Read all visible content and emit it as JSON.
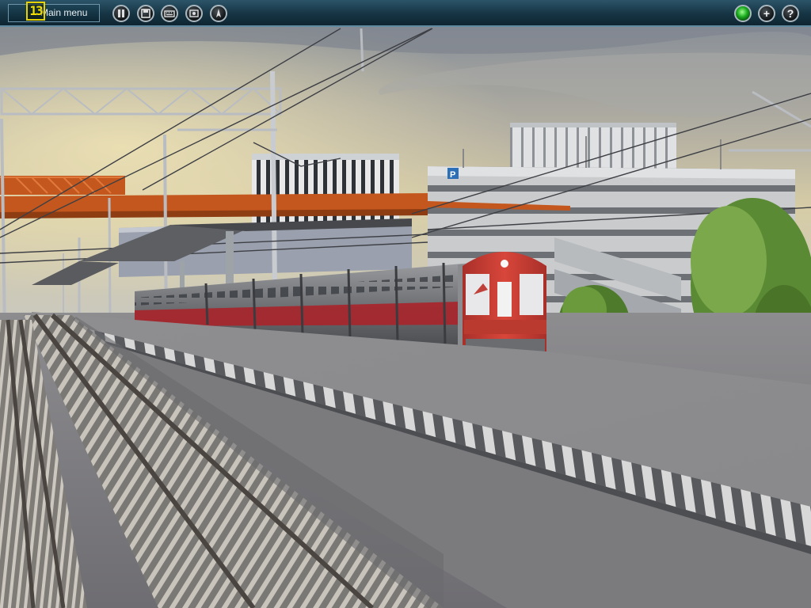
{
  "toolbar": {
    "menu_label": "Main menu",
    "fps_value": "13",
    "buttons": [
      {
        "name": "pause",
        "icon": "pause-icon"
      },
      {
        "name": "save",
        "icon": "save-icon"
      },
      {
        "name": "keyboard",
        "icon": "keyboard-icon"
      },
      {
        "name": "camera",
        "icon": "camera-icon"
      },
      {
        "name": "compass",
        "icon": "compass-icon"
      }
    ],
    "right_buttons": [
      {
        "name": "status",
        "icon": "status-light-icon",
        "color": "#22c02a"
      },
      {
        "name": "add",
        "icon": "plus-icon",
        "glyph": "+"
      },
      {
        "name": "help",
        "icon": "help-icon",
        "glyph": "?"
      }
    ]
  },
  "scene": {
    "parking_sign": "P",
    "colors": {
      "sky_top": "#8c929a",
      "sky_glow": "#d9cfa8",
      "train_nose": "#cc3b2f",
      "train_body": "#7a7c80",
      "train_stripe": "#a8242a",
      "overpass": "#c4571d"
    }
  }
}
